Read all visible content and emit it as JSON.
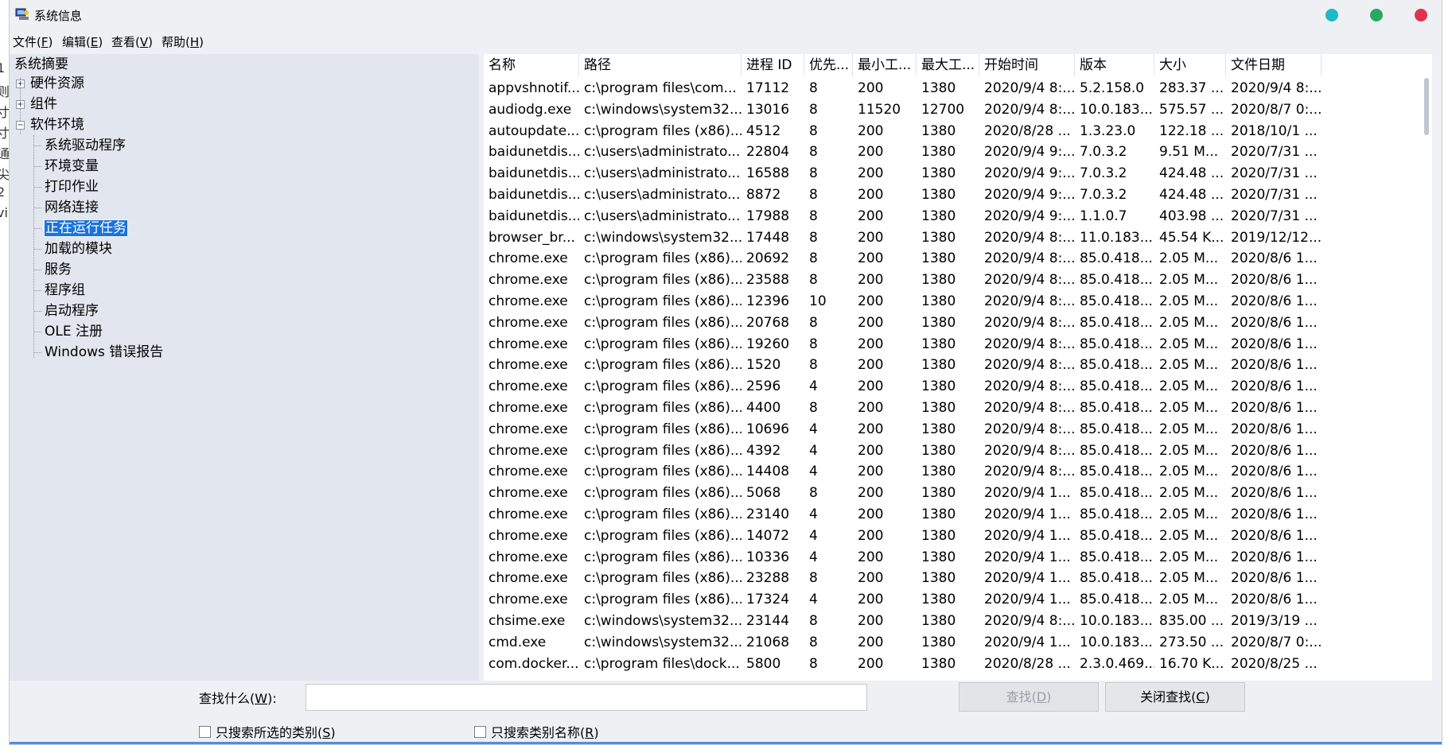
{
  "window": {
    "title": "系统信息",
    "controls": [
      {
        "name": "minimize",
        "color": "#1fb8c5"
      },
      {
        "name": "maximize",
        "color": "#28a860"
      },
      {
        "name": "close",
        "color": "#e0334d"
      }
    ]
  },
  "desk_sliver": [
    "1",
    "则",
    "寸",
    "寸",
    "通",
    "尖",
    "2",
    "vi"
  ],
  "menu": [
    {
      "label": "文件(",
      "key": "F",
      "end": ")"
    },
    {
      "label": "编辑(",
      "key": "E",
      "end": ")"
    },
    {
      "label": "查看(",
      "key": "V",
      "end": ")"
    },
    {
      "label": "帮助(",
      "key": "H",
      "end": ")"
    }
  ],
  "tree": {
    "root": "系统摘要",
    "groups": [
      {
        "label": "硬件资源",
        "expander": "+"
      },
      {
        "label": "组件",
        "expander": "+"
      },
      {
        "label": "软件环境",
        "expander": "−"
      }
    ],
    "children": [
      "系统驱动程序",
      "环境变量",
      "打印作业",
      "网络连接",
      "正在运行任务",
      "加载的模块",
      "服务",
      "程序组",
      "启动程序",
      "OLE 注册",
      "Windows 错误报告"
    ],
    "selected_index": 4
  },
  "table": {
    "columns": [
      "名称",
      "路径",
      "进程 ID",
      "优先...",
      "最小工...",
      "最大工...",
      "开始时间",
      "版本",
      "大小",
      "文件日期"
    ],
    "rows": [
      [
        "appvshnotif...",
        "c:\\program files\\com...",
        "17112",
        "8",
        "200",
        "1380",
        "2020/9/4 8:...",
        "5.2.158.0",
        "283.37 ...",
        "2020/9/4 8:..."
      ],
      [
        "audiodg.exe",
        "c:\\windows\\system32...",
        "13016",
        "8",
        "11520",
        "12700",
        "2020/9/4 8:...",
        "10.0.183...",
        "575.57 ...",
        "2020/8/7 0:..."
      ],
      [
        "autoupdate....",
        "c:\\program files (x86)...",
        "4512",
        "8",
        "200",
        "1380",
        "2020/8/28 ...",
        "1.3.23.0",
        "122.18 ...",
        "2018/10/1 ..."
      ],
      [
        "baidunetdis...",
        "c:\\users\\administrato...",
        "22804",
        "8",
        "200",
        "1380",
        "2020/9/4 9:...",
        "7.0.3.2",
        "9.51 M...",
        "2020/7/31 ..."
      ],
      [
        "baidunetdis...",
        "c:\\users\\administrato...",
        "16588",
        "8",
        "200",
        "1380",
        "2020/9/4 9:...",
        "7.0.3.2",
        "424.48 ...",
        "2020/7/31 ..."
      ],
      [
        "baidunetdis...",
        "c:\\users\\administrato...",
        "8872",
        "8",
        "200",
        "1380",
        "2020/9/4 9:...",
        "7.0.3.2",
        "424.48 ...",
        "2020/7/31 ..."
      ],
      [
        "baidunetdis...",
        "c:\\users\\administrato...",
        "17988",
        "8",
        "200",
        "1380",
        "2020/9/4 9:...",
        "1.1.0.7",
        "403.98 ...",
        "2020/7/31 ..."
      ],
      [
        "browser_br...",
        "c:\\windows\\system32...",
        "17448",
        "8",
        "200",
        "1380",
        "2020/9/4 8:...",
        "11.0.183...",
        "45.54 K...",
        "2019/12/12..."
      ],
      [
        "chrome.exe",
        "c:\\program files (x86)...",
        "20692",
        "8",
        "200",
        "1380",
        "2020/9/4 8:...",
        "85.0.418...",
        "2.05 M...",
        "2020/8/6 1..."
      ],
      [
        "chrome.exe",
        "c:\\program files (x86)...",
        "23588",
        "8",
        "200",
        "1380",
        "2020/9/4 8:...",
        "85.0.418...",
        "2.05 M...",
        "2020/8/6 1..."
      ],
      [
        "chrome.exe",
        "c:\\program files (x86)...",
        "12396",
        "10",
        "200",
        "1380",
        "2020/9/4 8:...",
        "85.0.418...",
        "2.05 M...",
        "2020/8/6 1..."
      ],
      [
        "chrome.exe",
        "c:\\program files (x86)...",
        "20768",
        "8",
        "200",
        "1380",
        "2020/9/4 8:...",
        "85.0.418...",
        "2.05 M...",
        "2020/8/6 1..."
      ],
      [
        "chrome.exe",
        "c:\\program files (x86)...",
        "19260",
        "8",
        "200",
        "1380",
        "2020/9/4 8:...",
        "85.0.418...",
        "2.05 M...",
        "2020/8/6 1..."
      ],
      [
        "chrome.exe",
        "c:\\program files (x86)...",
        "1520",
        "8",
        "200",
        "1380",
        "2020/9/4 8:...",
        "85.0.418...",
        "2.05 M...",
        "2020/8/6 1..."
      ],
      [
        "chrome.exe",
        "c:\\program files (x86)...",
        "2596",
        "4",
        "200",
        "1380",
        "2020/9/4 8:...",
        "85.0.418...",
        "2.05 M...",
        "2020/8/6 1..."
      ],
      [
        "chrome.exe",
        "c:\\program files (x86)...",
        "4400",
        "8",
        "200",
        "1380",
        "2020/9/4 8:...",
        "85.0.418...",
        "2.05 M...",
        "2020/8/6 1..."
      ],
      [
        "chrome.exe",
        "c:\\program files (x86)...",
        "10696",
        "4",
        "200",
        "1380",
        "2020/9/4 8:...",
        "85.0.418...",
        "2.05 M...",
        "2020/8/6 1..."
      ],
      [
        "chrome.exe",
        "c:\\program files (x86)...",
        "4392",
        "4",
        "200",
        "1380",
        "2020/9/4 8:...",
        "85.0.418...",
        "2.05 M...",
        "2020/8/6 1..."
      ],
      [
        "chrome.exe",
        "c:\\program files (x86)...",
        "14408",
        "4",
        "200",
        "1380",
        "2020/9/4 8:...",
        "85.0.418...",
        "2.05 M...",
        "2020/8/6 1..."
      ],
      [
        "chrome.exe",
        "c:\\program files (x86)...",
        "5068",
        "8",
        "200",
        "1380",
        "2020/9/4 1...",
        "85.0.418...",
        "2.05 M...",
        "2020/8/6 1..."
      ],
      [
        "chrome.exe",
        "c:\\program files (x86)...",
        "23140",
        "4",
        "200",
        "1380",
        "2020/9/4 1...",
        "85.0.418...",
        "2.05 M...",
        "2020/8/6 1..."
      ],
      [
        "chrome.exe",
        "c:\\program files (x86)...",
        "14072",
        "4",
        "200",
        "1380",
        "2020/9/4 1...",
        "85.0.418...",
        "2.05 M...",
        "2020/8/6 1..."
      ],
      [
        "chrome.exe",
        "c:\\program files (x86)...",
        "10336",
        "4",
        "200",
        "1380",
        "2020/9/4 1...",
        "85.0.418...",
        "2.05 M...",
        "2020/8/6 1..."
      ],
      [
        "chrome.exe",
        "c:\\program files (x86)...",
        "23288",
        "8",
        "200",
        "1380",
        "2020/9/4 1...",
        "85.0.418...",
        "2.05 M...",
        "2020/8/6 1..."
      ],
      [
        "chrome.exe",
        "c:\\program files (x86)...",
        "17324",
        "4",
        "200",
        "1380",
        "2020/9/4 1...",
        "85.0.418...",
        "2.05 M...",
        "2020/8/6 1..."
      ],
      [
        "chsime.exe",
        "c:\\windows\\system32...",
        "23144",
        "8",
        "200",
        "1380",
        "2020/9/4 8:...",
        "10.0.183...",
        "835.00 ...",
        "2019/3/19 ..."
      ],
      [
        "cmd.exe",
        "c:\\windows\\system32...",
        "21068",
        "8",
        "200",
        "1380",
        "2020/9/4 1...",
        "10.0.183...",
        "273.50 ...",
        "2020/8/7 0:..."
      ],
      [
        "com.docker....",
        "c:\\program files\\dock...",
        "5800",
        "8",
        "200",
        "1380",
        "2020/8/28 ...",
        "2.3.0.469...",
        "16.70 K...",
        "2020/8/25 ..."
      ]
    ]
  },
  "find": {
    "label": "查找什么(",
    "label_key": "W",
    "label_end": "):",
    "input_value": "",
    "find_button": {
      "label": "查找(",
      "key": "D",
      "end": ")"
    },
    "close_button": {
      "label": "关闭查找(",
      "key": "C",
      "end": ")"
    },
    "check1": {
      "label": "只搜索所选的类别(",
      "key": "S",
      "end": ")"
    },
    "check2": {
      "label": "只搜索类别名称(",
      "key": "R",
      "end": ")"
    }
  }
}
